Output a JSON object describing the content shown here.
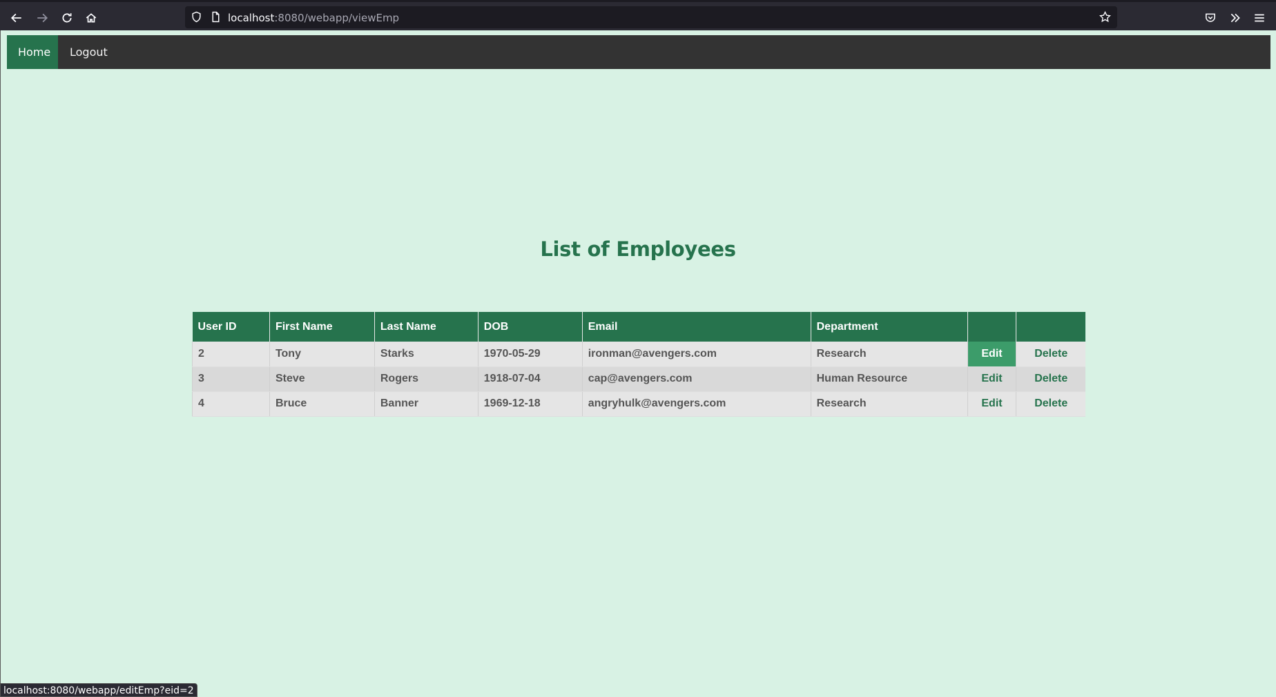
{
  "browser": {
    "url_host": "localhost",
    "url_rest": ":8080/webapp/viewEmp",
    "status_url": "localhost:8080/webapp/editEmp?eid=2"
  },
  "nav": {
    "home_label": "Home",
    "logout_label": "Logout"
  },
  "page": {
    "title": "List of Employees"
  },
  "table": {
    "headers": [
      "User ID",
      "First Name",
      "Last Name",
      "DOB",
      "Email",
      "Department",
      "",
      ""
    ],
    "rows": [
      {
        "id": "2",
        "first": "Tony",
        "last": "Starks",
        "dob": "1970-05-29",
        "email": "ironman@avengers.com",
        "dept": "Research",
        "edit": "Edit",
        "delete": "Delete"
      },
      {
        "id": "3",
        "first": "Steve",
        "last": "Rogers",
        "dob": "1918-07-04",
        "email": "cap@avengers.com",
        "dept": "Human Resource",
        "edit": "Edit",
        "delete": "Delete"
      },
      {
        "id": "4",
        "first": "Bruce",
        "last": "Banner",
        "dob": "1969-12-18",
        "email": "angryhulk@avengers.com",
        "dept": "Research",
        "edit": "Edit",
        "delete": "Delete"
      }
    ]
  },
  "colors": {
    "accent": "#26734d",
    "page_bg": "#d8f2e4",
    "navbar_bg": "#333333"
  }
}
